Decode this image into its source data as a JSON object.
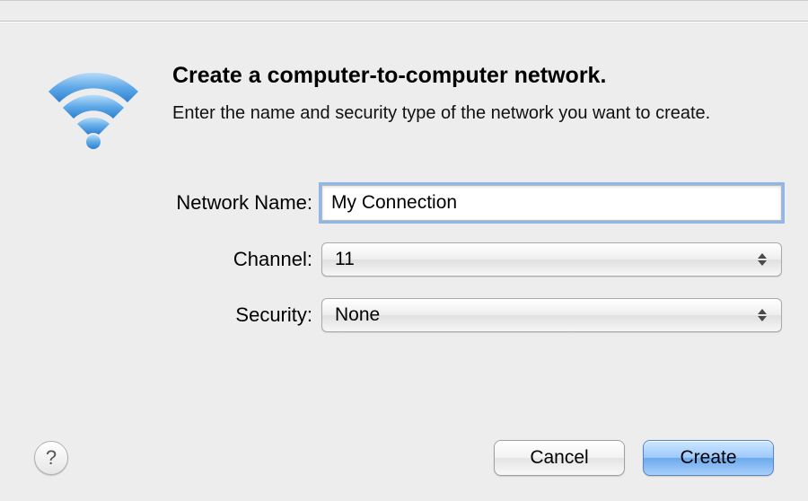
{
  "header": {
    "title": "Create a computer-to-computer network.",
    "subtitle": "Enter the name and security type of the network you want to create."
  },
  "form": {
    "network_name_label": "Network Name:",
    "network_name_value": "My Connection",
    "channel_label": "Channel:",
    "channel_value": "11",
    "security_label": "Security:",
    "security_value": "None"
  },
  "buttons": {
    "help_symbol": "?",
    "cancel": "Cancel",
    "create": "Create"
  }
}
